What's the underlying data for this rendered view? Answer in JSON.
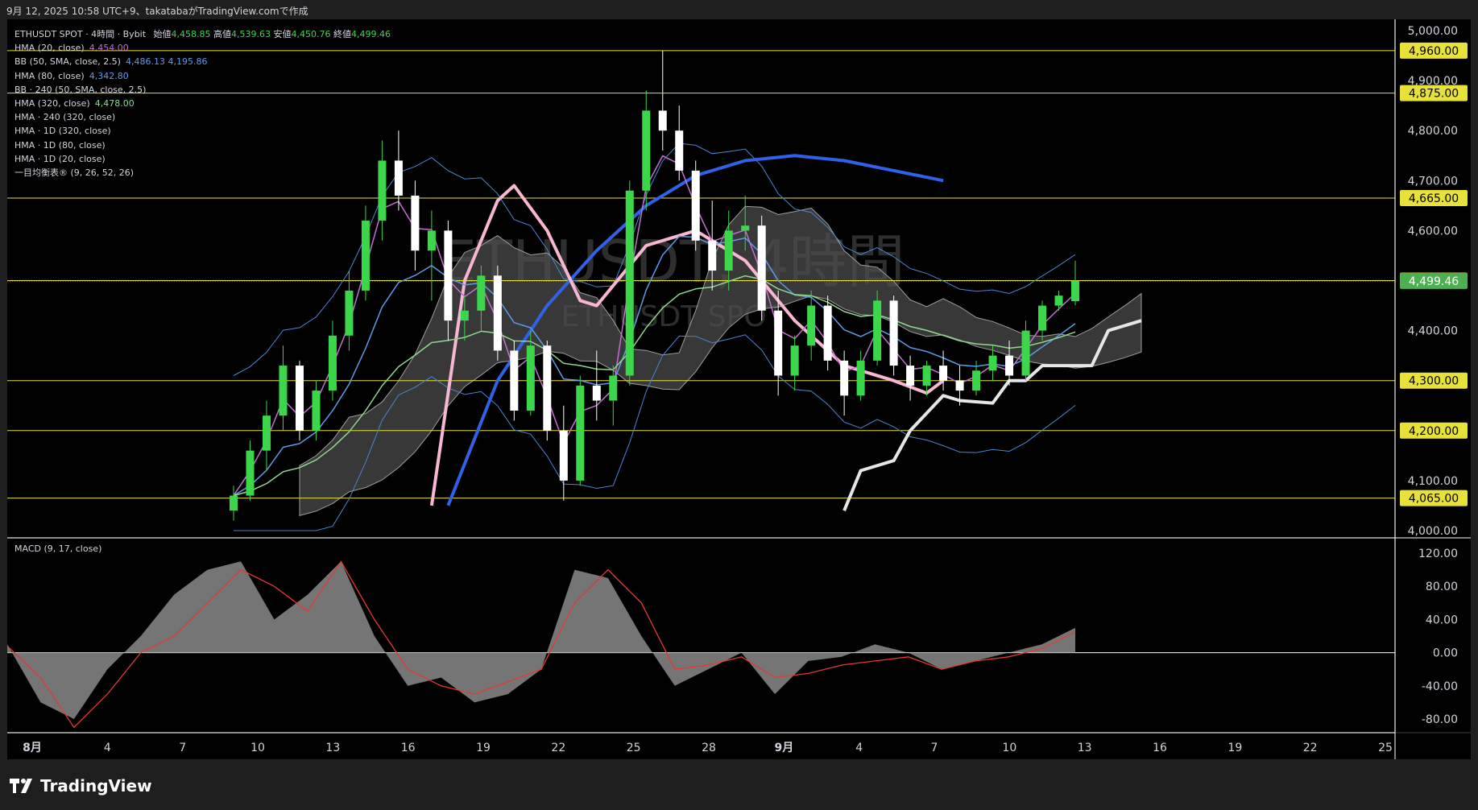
{
  "header": {
    "text": "9月 12, 2025 10:58 UTC+9、takatabaがTradingView.comで作成"
  },
  "legend": {
    "main": {
      "symbol": "ETHUSDT SPOT · 4時間 · Bybit",
      "o_label": "始値",
      "o": "4,458.85",
      "h_label": "高値",
      "h": "4,539.63",
      "l_label": "安値",
      "l": "4,450.76",
      "c_label": "終値",
      "c": "4,499.46"
    },
    "indicators": [
      {
        "name": "HMA (20, close)",
        "value": "4,454.00",
        "color": "#c46fd1"
      },
      {
        "name": "BB (50, SMA, close, 2.5)",
        "value": "4,486.13  4,195.86",
        "color": "#5d9be8"
      },
      {
        "name": "HMA (80, close)",
        "value": "4,342.80",
        "color": "#5d9be8"
      },
      {
        "name": "BB · 240 (50, SMA, close, 2.5)",
        "value": "",
        "color": "#d1d4dc"
      },
      {
        "name": "HMA (320, close)",
        "value": "4,478.00",
        "color": "#8fd88f"
      },
      {
        "name": "HMA · 240 (320, close)",
        "value": "",
        "color": "#d1d4dc"
      },
      {
        "name": "HMA · 1D (320, close)",
        "value": "",
        "color": "#d1d4dc"
      },
      {
        "name": "HMA · 1D (80, close)",
        "value": "",
        "color": "#d1d4dc"
      },
      {
        "name": "HMA · 1D (20, close)",
        "value": "",
        "color": "#d1d4dc"
      },
      {
        "name": "一目均衡表® (9, 26, 52, 26)",
        "value": "",
        "color": "#d1d4dc"
      }
    ]
  },
  "watermark": {
    "line1": "ETHUSDT, 4時間",
    "line2": "ETHUSDT SPOT"
  },
  "macd": {
    "label": "MACD (9, 17, close)",
    "ticks": [
      "120.00",
      "80.00",
      "40.00",
      "0.00",
      "-40.00",
      "-80.00"
    ],
    "tick_values": [
      120,
      80,
      40,
      0,
      -40,
      -80
    ]
  },
  "price_axis": {
    "ticks": [
      "5,000.00",
      "4,900.00",
      "4,800.00",
      "4,700.00",
      "4,600.00",
      "4,400.00",
      "4,100.00",
      "4,000.00"
    ],
    "tick_values": [
      5000,
      4900,
      4800,
      4700,
      4600,
      4400,
      4100,
      4000
    ],
    "levels": [
      "4,960.00",
      "4,875.00",
      "4,665.00",
      "4,500.00",
      "4,300.00",
      "4,200.00",
      "4,065.00"
    ],
    "level_values": [
      4960,
      4875,
      4665,
      4500,
      4300,
      4200,
      4065
    ],
    "last_price": "4,499.46",
    "last_price_value": 4499.46
  },
  "time_axis": {
    "labels": [
      "8月",
      "4",
      "7",
      "10",
      "13",
      "16",
      "19",
      "22",
      "25",
      "28",
      "9月",
      "4",
      "7",
      "10",
      "13",
      "16",
      "19",
      "22",
      "25"
    ]
  },
  "brand": {
    "name": "TradingView"
  },
  "colors": {
    "bg": "#000000",
    "frame": "#1e1e1e",
    "up": "#3bd64a",
    "down": "#ffffff",
    "level": "#e8e13a",
    "last": "#4caf50",
    "hma20": "#c46fd1",
    "bb": "#4a86d4",
    "hma80": "#5d9be8",
    "hma320": "#8fd88f",
    "d1_320": "#2f62e6",
    "d1_80": "#f7b6d2",
    "d1_20": "#e6e6e6",
    "cloud": "#505050",
    "macd_line": "#e53935",
    "macd_hist": "#8a8a8a"
  },
  "chart_data": {
    "type": "candlestick",
    "symbol": "ETHUSDT SPOT",
    "timeframe": "4時間",
    "ylim": [
      4000,
      5000
    ],
    "candles_ohlc": [
      [
        4040,
        4090,
        4020,
        4070
      ],
      [
        4070,
        4180,
        4060,
        4160
      ],
      [
        4160,
        4260,
        4120,
        4230
      ],
      [
        4230,
        4370,
        4200,
        4330
      ],
      [
        4330,
        4340,
        4180,
        4200
      ],
      [
        4200,
        4300,
        4180,
        4280
      ],
      [
        4280,
        4420,
        4260,
        4390
      ],
      [
        4390,
        4520,
        4360,
        4480
      ],
      [
        4480,
        4650,
        4460,
        4620
      ],
      [
        4620,
        4780,
        4580,
        4740
      ],
      [
        4740,
        4800,
        4640,
        4670
      ],
      [
        4670,
        4700,
        4520,
        4560
      ],
      [
        4560,
        4640,
        4460,
        4600
      ],
      [
        4600,
        4620,
        4380,
        4420
      ],
      [
        4420,
        4470,
        4380,
        4440
      ],
      [
        4440,
        4530,
        4400,
        4510
      ],
      [
        4510,
        4530,
        4340,
        4360
      ],
      [
        4360,
        4380,
        4220,
        4240
      ],
      [
        4240,
        4400,
        4230,
        4370
      ],
      [
        4370,
        4380,
        4180,
        4200
      ],
      [
        4200,
        4250,
        4060,
        4100
      ],
      [
        4100,
        4310,
        4090,
        4290
      ],
      [
        4290,
        4360,
        4220,
        4260
      ],
      [
        4260,
        4330,
        4210,
        4310
      ],
      [
        4310,
        4700,
        4290,
        4680
      ],
      [
        4680,
        4880,
        4640,
        4840
      ],
      [
        4840,
        4960,
        4760,
        4800
      ],
      [
        4800,
        4850,
        4700,
        4720
      ],
      [
        4720,
        4740,
        4560,
        4580
      ],
      [
        4580,
        4660,
        4480,
        4520
      ],
      [
        4520,
        4640,
        4480,
        4600
      ],
      [
        4600,
        4670,
        4560,
        4610
      ],
      [
        4610,
        4630,
        4420,
        4440
      ],
      [
        4440,
        4480,
        4270,
        4310
      ],
      [
        4310,
        4390,
        4280,
        4370
      ],
      [
        4370,
        4480,
        4340,
        4450
      ],
      [
        4450,
        4470,
        4320,
        4340
      ],
      [
        4340,
        4360,
        4230,
        4270
      ],
      [
        4270,
        4360,
        4260,
        4340
      ],
      [
        4340,
        4480,
        4330,
        4460
      ],
      [
        4460,
        4470,
        4310,
        4330
      ],
      [
        4330,
        4350,
        4260,
        4290
      ],
      [
        4290,
        4340,
        4270,
        4330
      ],
      [
        4330,
        4360,
        4280,
        4300
      ],
      [
        4300,
        4330,
        4250,
        4280
      ],
      [
        4280,
        4340,
        4270,
        4320
      ],
      [
        4320,
        4370,
        4300,
        4350
      ],
      [
        4350,
        4380,
        4290,
        4310
      ],
      [
        4310,
        4420,
        4300,
        4400
      ],
      [
        4400,
        4460,
        4380,
        4450
      ],
      [
        4450,
        4480,
        4440,
        4470
      ],
      [
        4458.85,
        4539.63,
        4450.76,
        4499.46
      ]
    ],
    "levels": [
      4960,
      4875,
      4665,
      4500,
      4300,
      4200,
      4065
    ],
    "last": 4499.46,
    "hma20_last": 4454.0,
    "bb_upper_last": 4486.13,
    "bb_lower_last": 4195.86,
    "hma80_last": 4342.8,
    "hma320_last": 4478.0,
    "line_hma_1d_320": [
      [
        13,
        4050
      ],
      [
        16,
        4300
      ],
      [
        19,
        4450
      ],
      [
        22,
        4560
      ],
      [
        25,
        4650
      ],
      [
        28,
        4710
      ],
      [
        31,
        4740
      ],
      [
        34,
        4750
      ],
      [
        37,
        4740
      ],
      [
        40,
        4720
      ],
      [
        43,
        4700
      ]
    ],
    "line_hma_1d_80": [
      [
        12,
        4050
      ],
      [
        14,
        4500
      ],
      [
        16,
        4660
      ],
      [
        17,
        4690
      ],
      [
        19,
        4600
      ],
      [
        21,
        4460
      ],
      [
        22,
        4450
      ],
      [
        25,
        4570
      ],
      [
        28,
        4600
      ],
      [
        31,
        4540
      ],
      [
        34,
        4420
      ],
      [
        37,
        4330
      ],
      [
        40,
        4300
      ],
      [
        42,
        4275
      ],
      [
        43,
        4300
      ]
    ],
    "line_hma_1d_20": [
      [
        37,
        4040
      ],
      [
        38,
        4120
      ],
      [
        40,
        4140
      ],
      [
        41,
        4200
      ],
      [
        43,
        4270
      ],
      [
        44,
        4260
      ],
      [
        46,
        4255
      ],
      [
        47,
        4300
      ],
      [
        48,
        4300
      ],
      [
        49,
        4330
      ],
      [
        52,
        4330
      ],
      [
        53,
        4400
      ],
      [
        55,
        4420
      ]
    ],
    "macd": {
      "signal": [
        8,
        -30,
        -90,
        -50,
        0,
        20,
        60,
        100,
        80,
        50,
        110,
        40,
        -20,
        -40,
        -50,
        -35,
        -20,
        60,
        100,
        60,
        -20,
        -15,
        -5,
        -30,
        -25,
        -15,
        -10,
        -5,
        -20,
        -10,
        -5,
        5,
        25
      ],
      "hist": [
        10,
        -60,
        -80,
        -20,
        20,
        70,
        100,
        110,
        40,
        70,
        110,
        20,
        -40,
        -30,
        -60,
        -50,
        -20,
        100,
        90,
        20,
        -40,
        -20,
        0,
        -50,
        -10,
        -5,
        10,
        0,
        -20,
        -10,
        0,
        10,
        30
      ]
    }
  }
}
